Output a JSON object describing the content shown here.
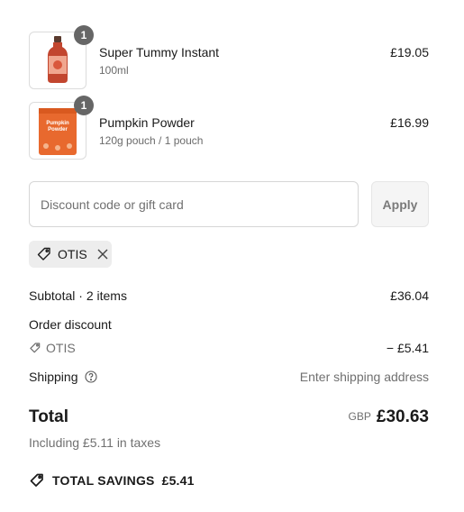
{
  "cart": {
    "items": [
      {
        "name": "Super Tummy Instant",
        "variant": "100ml",
        "price": "£19.05",
        "quantity": "1",
        "image": "bottle-image"
      },
      {
        "name": "Pumpkin Powder",
        "variant": "120g pouch / 1 pouch",
        "price": "£16.99",
        "quantity": "1",
        "image": "pouch-image",
        "pouch_text": "Pumpkin Powder"
      }
    ]
  },
  "discount": {
    "placeholder": "Discount code or gift card",
    "value": "",
    "apply_label": "Apply",
    "applied_code": "OTIS"
  },
  "summary": {
    "subtotal_label": "Subtotal · 2 items",
    "subtotal_value": "£36.04",
    "order_discount_label": "Order discount",
    "discount_code": "OTIS",
    "discount_value": "− £5.41",
    "shipping_label": "Shipping",
    "shipping_value": "Enter shipping address",
    "total_label": "Total",
    "currency": "GBP",
    "total_value": "£30.63",
    "taxes_note": "Including £5.11 in taxes",
    "savings_label": "TOTAL SAVINGS",
    "savings_value": "£5.41"
  },
  "colors": {
    "text": "#1a1a1a",
    "muted": "#707070",
    "badge": "#666666",
    "chip": "#ededed",
    "bottle": "#e07a5f",
    "pouch": "#e8692e"
  }
}
